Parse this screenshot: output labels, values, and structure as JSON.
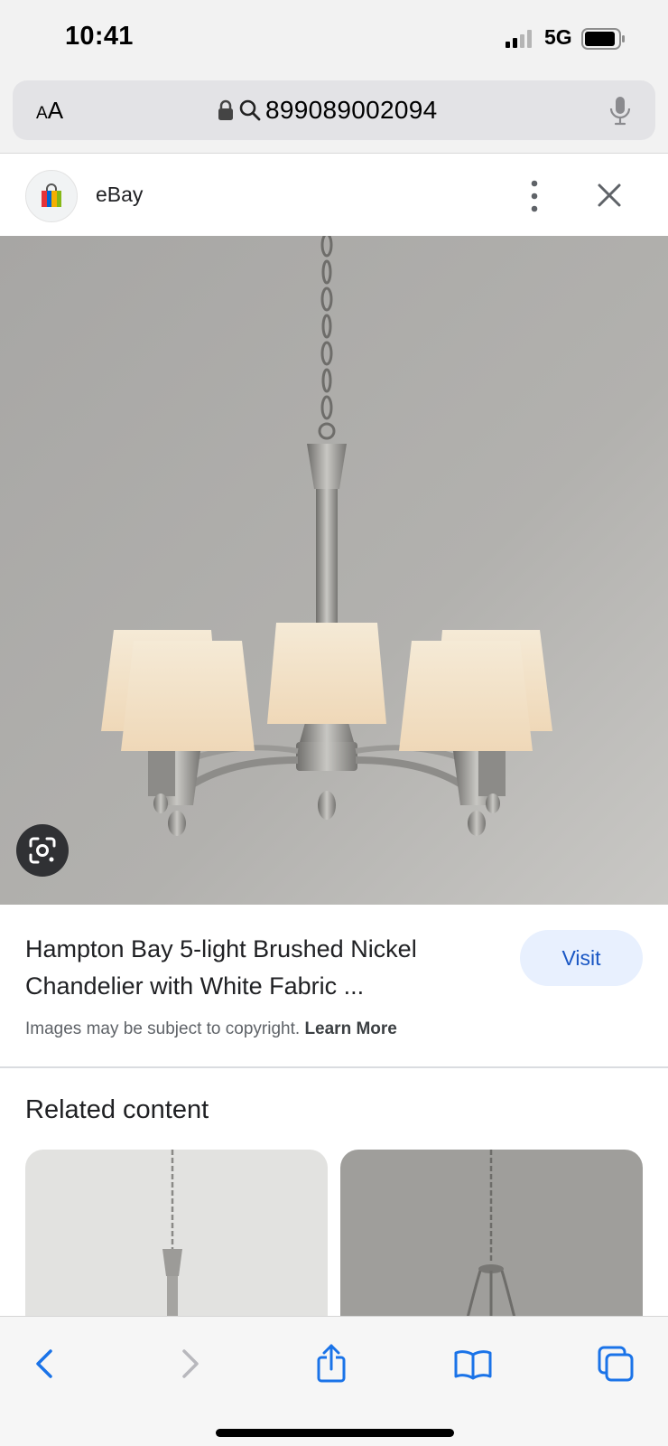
{
  "status_bar": {
    "time": "10:41",
    "network": "5G",
    "signal_icon": "signal-bars-icon",
    "battery_icon": "battery-icon"
  },
  "address_bar": {
    "text_size_label_small": "A",
    "text_size_label_large": "A",
    "url_text": "899089002094",
    "lock_icon": "lock-icon",
    "search_icon": "search-icon",
    "mic_icon": "microphone-icon"
  },
  "site_header": {
    "name": "eBay",
    "logo_icon": "ebay-bag-icon",
    "more_icon": "more-vertical-icon",
    "close_icon": "close-icon"
  },
  "hero": {
    "lens_icon": "google-lens-icon"
  },
  "result": {
    "title": "Hampton Bay 5-light Brushed Nickel Chandelier with White Fabric ...",
    "visit_label": "Visit",
    "copyright_text": "Images may be subject to copyright.",
    "learn_more_label": "Learn More"
  },
  "related": {
    "heading": "Related content"
  },
  "toolbar": {
    "back_icon": "back-chevron-icon",
    "forward_icon": "forward-chevron-icon",
    "share_icon": "share-icon",
    "bookmarks_icon": "bookmarks-icon",
    "tabs_icon": "tabs-icon"
  },
  "colors": {
    "accent_button_bg": "#e8f0fe",
    "accent_button_text": "#1a57c4",
    "safari_blue": "#1a73e8",
    "chrome_bg": "#f2f2f2"
  }
}
